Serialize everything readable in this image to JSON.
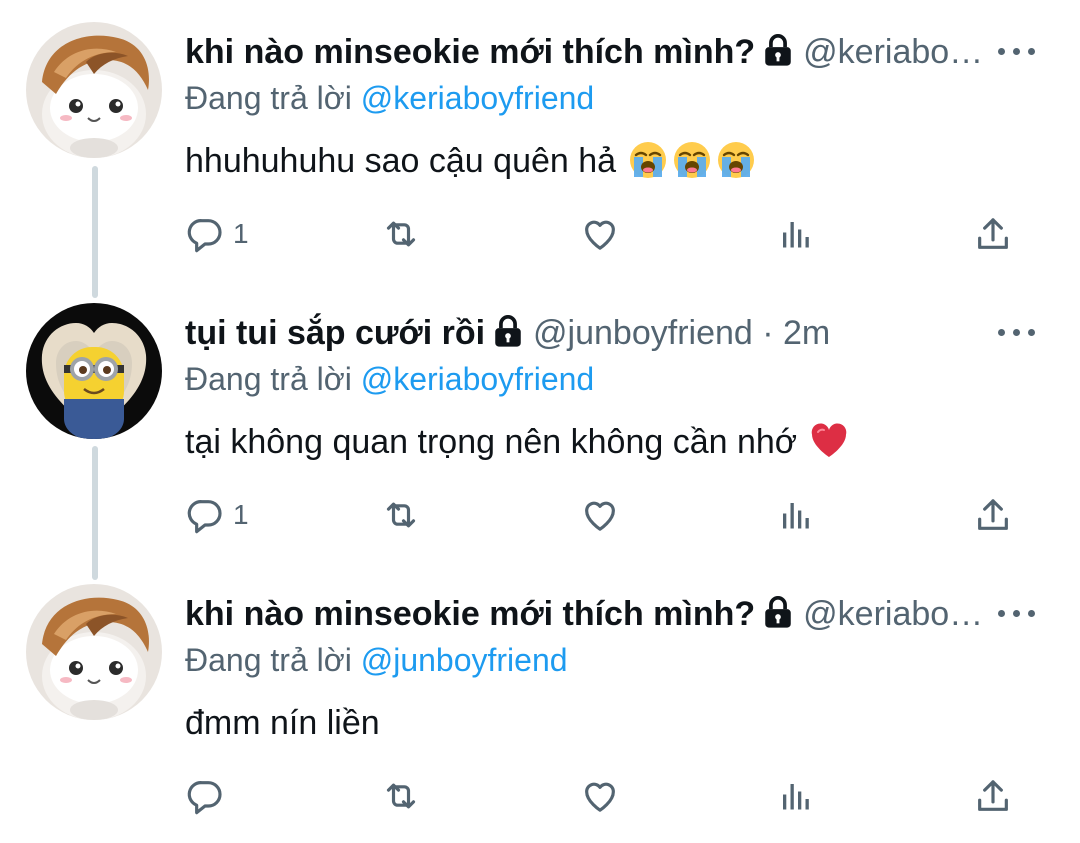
{
  "tweets": [
    {
      "avatar": "plush-hamster-avatar",
      "name": "khi nào minseokie mới thích mình?",
      "handle": "@keriabo…",
      "time": "",
      "reply_prefix": "Đang trả lời ",
      "reply_to": "@keriaboyfriend",
      "text": "hhuhuhuhu sao cậu quên hả",
      "emoji": [
        "loudly-crying-face",
        "loudly-crying-face",
        "loudly-crying-face"
      ],
      "reply_count": "1"
    },
    {
      "avatar": "minion-heart-avatar",
      "name": "tụi tui sắp cưới rồi",
      "handle": "@junboyfriend",
      "time": " · 2m",
      "reply_prefix": "Đang trả lời ",
      "reply_to": "@keriaboyfriend",
      "text": "tại không quan trọng nên không cần nhớ",
      "emoji": [
        "red-heart"
      ],
      "reply_count": "1"
    },
    {
      "avatar": "plush-hamster-avatar",
      "name": "khi nào minseokie mới thích mình?",
      "handle": "@keriabo…",
      "time": "",
      "reply_prefix": "Đang trả lời ",
      "reply_to": "@junboyfriend",
      "text": "đmm nín liền",
      "emoji": [],
      "reply_count": ""
    }
  ],
  "colors": {
    "text": "#0f1419",
    "secondary": "#536471",
    "link": "#1d9bf0",
    "thread_line": "#cfd9de"
  },
  "icons": [
    "reply-icon",
    "retweet-icon",
    "like-icon",
    "views-icon",
    "share-icon",
    "more-icon",
    "lock-icon"
  ]
}
